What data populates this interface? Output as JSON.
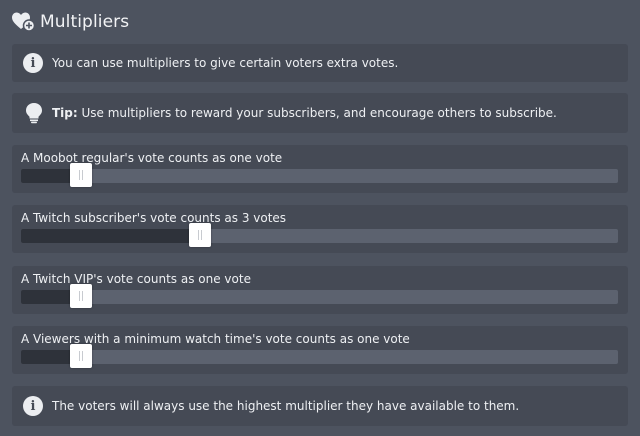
{
  "header": {
    "title": "Multipliers",
    "icon": "hearts-plus-icon"
  },
  "info_top": {
    "text": "You can use multipliers to give certain voters extra votes.",
    "icon": "info-icon"
  },
  "tip": {
    "bold": "Tip:",
    "text": " Use multipliers to reward your subscribers, and encourage others to subscribe.",
    "icon": "lightbulb-icon"
  },
  "sliders": [
    {
      "label": "A Moobot regular's vote counts as one vote",
      "value": 1,
      "level": 0.1
    },
    {
      "label": "A Twitch subscriber's vote counts as 3 votes",
      "value": 3,
      "level": 0.3
    },
    {
      "label": "A Twitch VIP's vote counts as one vote",
      "value": 1,
      "level": 0.1
    },
    {
      "label": "A Viewers with a minimum watch time's vote counts as one vote",
      "value": 1,
      "level": 0.1
    }
  ],
  "info_bottom": {
    "text": "The voters will always use the highest multiplier they have available to them.",
    "icon": "info-icon"
  },
  "colors": {
    "background": "#4d535f",
    "panel": "#454a55",
    "track": "#5c626f",
    "fill": "#2e323a",
    "handle": "#ffffff"
  }
}
